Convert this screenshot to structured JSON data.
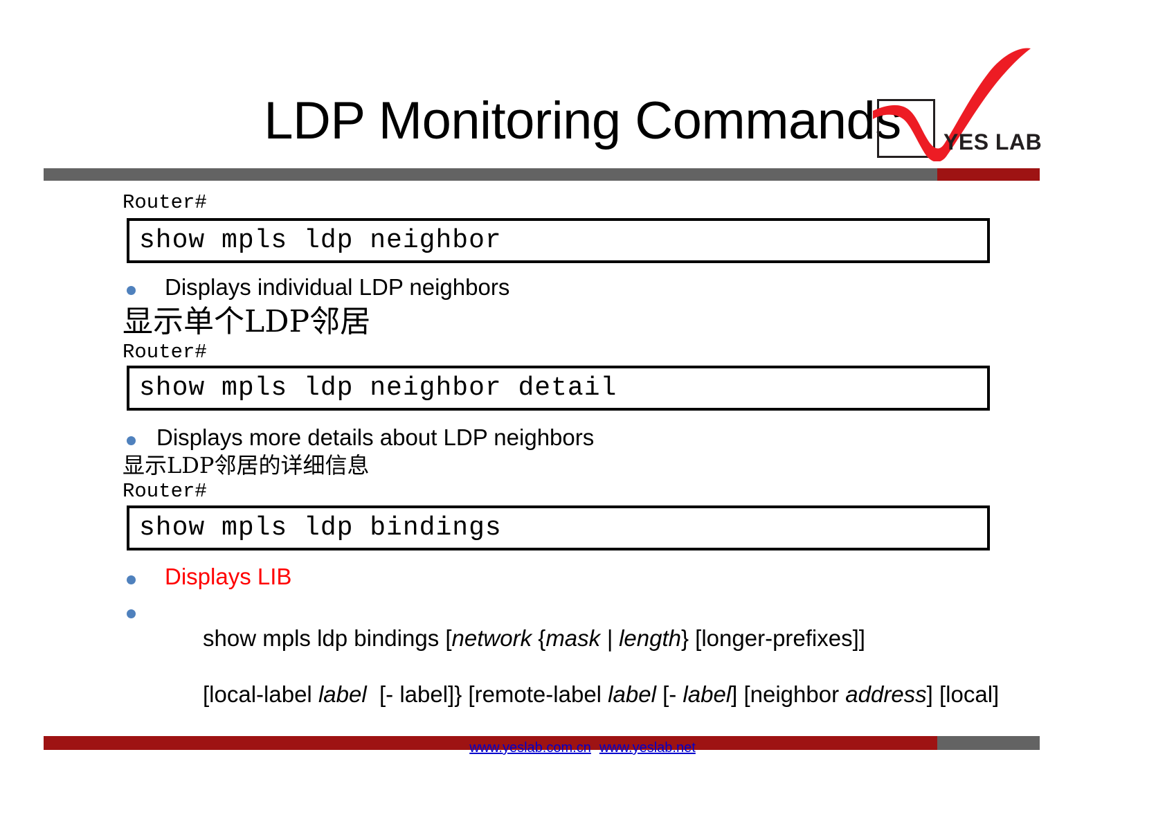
{
  "slide": {
    "title": "LDP Monitoring Commands",
    "logo": {
      "text": "YES LAB",
      "check_color": "#ed1c24",
      "box_color": "#231f20"
    },
    "header_bar": {
      "gray": "#636363",
      "red": "#9e1313"
    },
    "blocks": [
      {
        "prompt": "Router#",
        "command": "show mpls ldp neighbor",
        "bullet": "Displays individual LDP neighbors",
        "bullet_color": "#000000",
        "translation": "显示单个LDP邻居"
      },
      {
        "prompt": "Router#",
        "command": "show mpls ldp neighbor detail",
        "bullet": "Displays more details about LDP neighbors",
        "bullet_color": "#000000",
        "translation": "显示LDP邻居的详细信息"
      },
      {
        "prompt": "Router#",
        "command": "show mpls ldp bindings",
        "bullet": "Displays LIB",
        "bullet_color": "#ff0000",
        "translation": ""
      }
    ],
    "syntax_bullet": {
      "line1_plain_a": "show mpls ldp bindings [",
      "line1_italic_a": "network",
      "line1_plain_b": " {",
      "line1_italic_b": "mask | length",
      "line1_plain_c": "} [longer-prefixes]]",
      "line2_plain_a": "[local-label ",
      "line2_italic_a": "label",
      "line2_plain_b": "  [- label]} [remote-label ",
      "line2_italic_b": "label",
      "line2_plain_c": " [- ",
      "line2_italic_c": "label",
      "line2_plain_d": "] [neighbor ",
      "line2_italic_d": "address",
      "line2_plain_e": "] [local]"
    },
    "footer": {
      "link1": "www.yeslab.com.cn",
      "link2": "www.yeslab.net",
      "bar_red": "#9e1313",
      "bar_gray": "#636363"
    }
  }
}
